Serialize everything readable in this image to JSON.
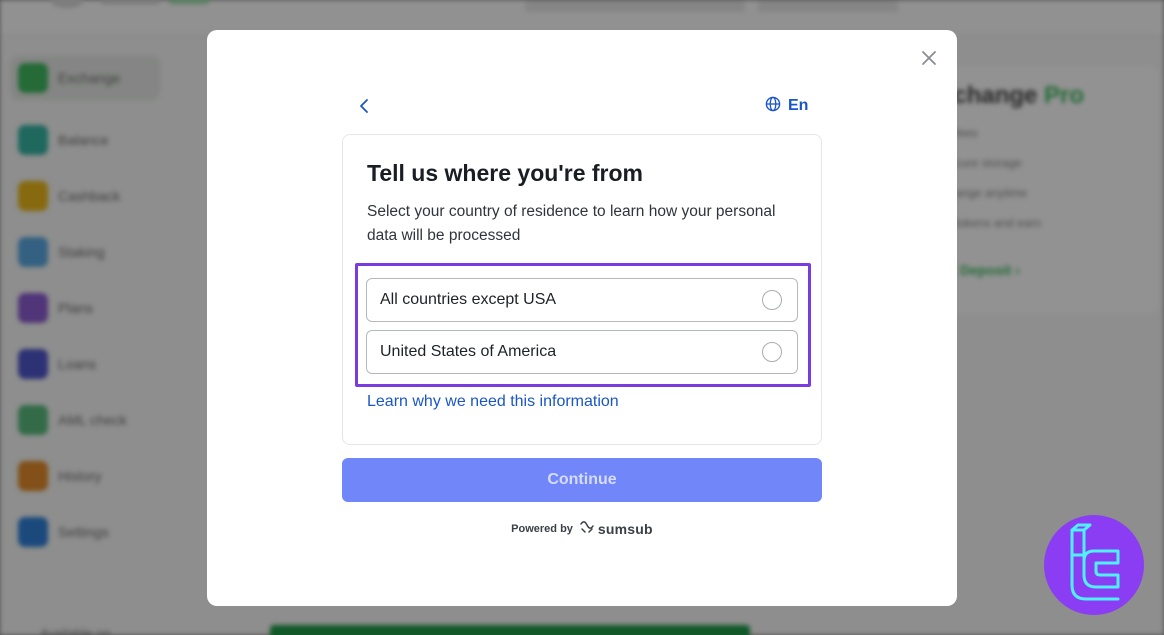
{
  "background": {
    "sidebar_items": [
      {
        "label": "Exchange",
        "icon": "exchange-icon",
        "color": "#3fb85f",
        "active": true
      },
      {
        "label": "Balance",
        "icon": "wallet-icon",
        "color": "#35b3a3"
      },
      {
        "label": "Cashback",
        "icon": "cashback-icon",
        "color": "#e9b71a"
      },
      {
        "label": "Staking",
        "icon": "staking-icon",
        "color": "#5aa7df"
      },
      {
        "label": "Plans",
        "icon": "plans-icon",
        "color": "#8b5ccf"
      },
      {
        "label": "Loans",
        "icon": "loans-icon",
        "color": "#4d56c9"
      },
      {
        "label": "AML check",
        "icon": "aml-icon",
        "color": "#59b97d"
      },
      {
        "label": "History",
        "icon": "history-icon",
        "color": "#e08a2a"
      },
      {
        "label": "Settings",
        "icon": "settings-icon",
        "color": "#2f7fd6"
      }
    ],
    "available_label": "Available on",
    "promo": {
      "title_main": "xchange",
      "title_accent": "Pro",
      "lines": [
        "fees",
        "cure storage",
        "ange anytime",
        "tokens and earn"
      ],
      "deposit_label": "Deposit ›"
    }
  },
  "modal": {
    "close_icon": "close-icon",
    "back_icon": "chevron-left-icon",
    "language": {
      "icon": "globe-icon",
      "label": "En"
    },
    "title": "Tell us where you're from",
    "subtitle": "Select your country of residence to learn how your personal data will be processed",
    "options": [
      {
        "label": "All countries except USA",
        "selected": false
      },
      {
        "label": "United States of America",
        "selected": false
      }
    ],
    "learn_link": "Learn why we need this information",
    "continue_label": "Continue",
    "powered_by": "Powered by",
    "brand": "sumsub"
  },
  "colors": {
    "accent_link": "#1a56c9",
    "continue_bg": "#7186f8",
    "highlight_border": "#7a3be0",
    "watermark_bg": "#8a3df2"
  }
}
